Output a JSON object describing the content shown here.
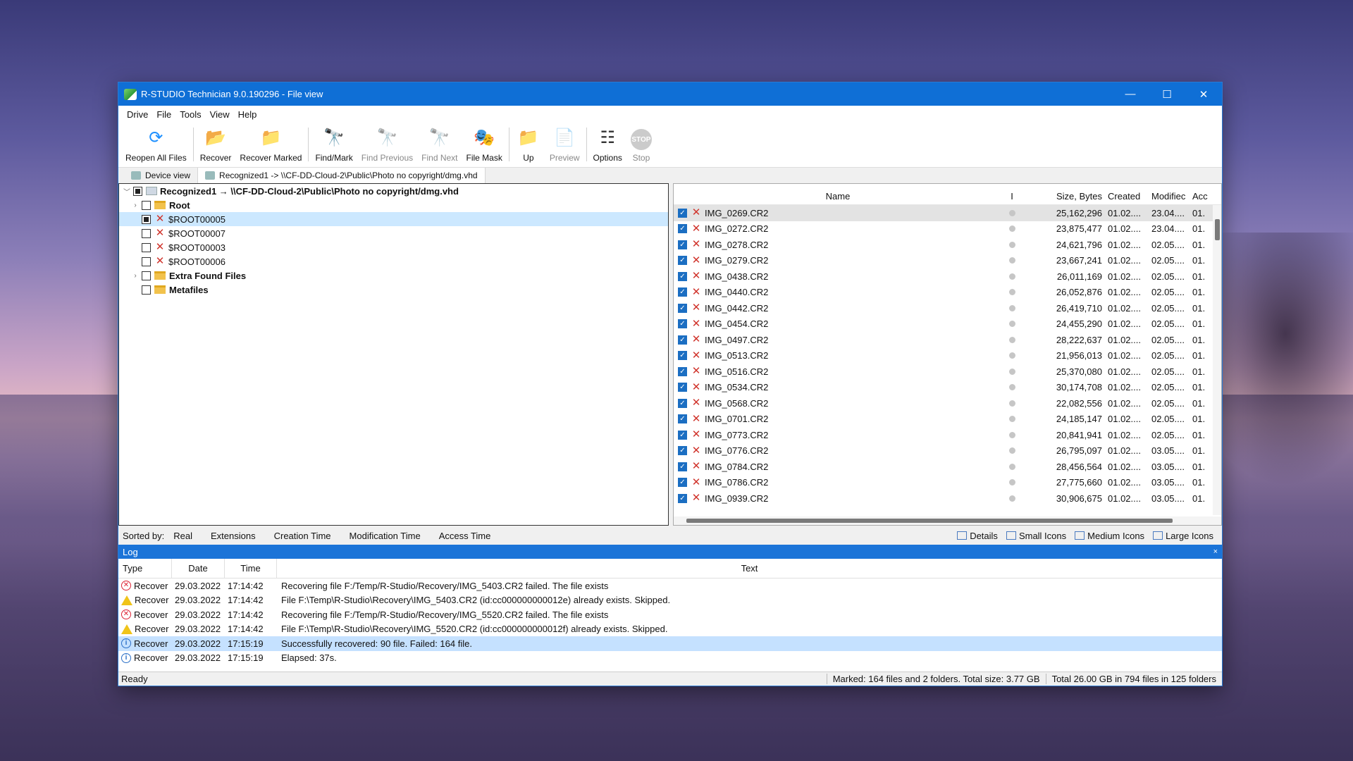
{
  "window": {
    "title": "R-STUDIO Technician 9.0.190296 - File view",
    "controls": {
      "minimize": "—",
      "maximize": "☐",
      "close": "✕"
    }
  },
  "menu": [
    "Drive",
    "File",
    "Tools",
    "View",
    "Help"
  ],
  "toolbar": [
    {
      "label": "Reopen All Files",
      "icon": "reopen-icon",
      "glyph": "⟳",
      "color": "#1e90ff",
      "disabled": false
    },
    {
      "label": "Recover",
      "icon": "recover-icon",
      "glyph": "📂",
      "color": "#c0392b",
      "disabled": false
    },
    {
      "label": "Recover Marked",
      "icon": "recover-marked-icon",
      "glyph": "📁",
      "color": "#c0392b",
      "disabled": false
    },
    {
      "label": "Find/Mark",
      "icon": "binoculars-icon",
      "glyph": "🔭",
      "color": "#444",
      "disabled": false
    },
    {
      "label": "Find Previous",
      "icon": "find-previous-icon",
      "glyph": "🔭",
      "color": "#888",
      "disabled": true
    },
    {
      "label": "Find Next",
      "icon": "find-next-icon",
      "glyph": "🔭",
      "color": "#888",
      "disabled": true
    },
    {
      "label": "File Mask",
      "icon": "file-mask-icon",
      "glyph": "🎭",
      "color": "#e0a820",
      "disabled": false
    },
    {
      "label": "Up",
      "icon": "folder-up-icon",
      "glyph": "📁",
      "color": "#e0a820",
      "disabled": false
    },
    {
      "label": "Preview",
      "icon": "preview-icon",
      "glyph": "📄",
      "color": "#888",
      "disabled": true
    },
    {
      "label": "Options",
      "icon": "options-icon",
      "glyph": "☷",
      "color": "#333",
      "disabled": false
    },
    {
      "label": "Stop",
      "icon": "stop-icon",
      "glyph": "STOP",
      "color": "#888",
      "disabled": true
    }
  ],
  "tabs": [
    {
      "label": "Device view",
      "active": false
    },
    {
      "label": "Recognized1 -> \\\\CF-DD-Cloud-2\\Public\\Photo no copyright/dmg.vhd",
      "active": true
    }
  ],
  "tree": [
    {
      "label": "Recognized1 → \\\\CF-DD-Cloud-2\\Public\\Photo no copyright/dmg.vhd",
      "level": 0,
      "expander": "﹀",
      "check": "partial",
      "icon": "drive-icon",
      "bold": true,
      "selected": false
    },
    {
      "label": "Root",
      "level": 1,
      "expander": "›",
      "check": "none",
      "icon": "folder-icon",
      "bold": true,
      "selected": false
    },
    {
      "label": "$ROOT00005",
      "level": 1,
      "expander": "",
      "check": "partial",
      "icon": "deleted-icon",
      "bold": false,
      "selected": true
    },
    {
      "label": "$ROOT00007",
      "level": 1,
      "expander": "",
      "check": "none",
      "icon": "deleted-icon",
      "bold": false,
      "selected": false
    },
    {
      "label": "$ROOT00003",
      "level": 1,
      "expander": "",
      "check": "none",
      "icon": "deleted-icon",
      "bold": false,
      "selected": false
    },
    {
      "label": "$ROOT00006",
      "level": 1,
      "expander": "",
      "check": "none",
      "icon": "deleted-icon",
      "bold": false,
      "selected": false
    },
    {
      "label": "Extra Found Files",
      "level": 1,
      "expander": "›",
      "check": "none",
      "icon": "folder-icon",
      "bold": true,
      "selected": false
    },
    {
      "label": "Metafiles",
      "level": 1,
      "expander": "",
      "check": "none",
      "icon": "folder-icon",
      "bold": true,
      "selected": false
    }
  ],
  "files": {
    "columns": [
      "Name",
      "I",
      "Size, Bytes",
      "Created",
      "Modifiec",
      "Acc"
    ],
    "rows": [
      {
        "name": "IMG_0269.CR2",
        "size": "25,162,296",
        "created": "01.02....",
        "modified": "23.04....",
        "accessed": "01."
      },
      {
        "name": "IMG_0272.CR2",
        "size": "23,875,477",
        "created": "01.02....",
        "modified": "23.04....",
        "accessed": "01."
      },
      {
        "name": "IMG_0278.CR2",
        "size": "24,621,796",
        "created": "01.02....",
        "modified": "02.05....",
        "accessed": "01."
      },
      {
        "name": "IMG_0279.CR2",
        "size": "23,667,241",
        "created": "01.02....",
        "modified": "02.05....",
        "accessed": "01."
      },
      {
        "name": "IMG_0438.CR2",
        "size": "26,011,169",
        "created": "01.02....",
        "modified": "02.05....",
        "accessed": "01."
      },
      {
        "name": "IMG_0440.CR2",
        "size": "26,052,876",
        "created": "01.02....",
        "modified": "02.05....",
        "accessed": "01."
      },
      {
        "name": "IMG_0442.CR2",
        "size": "26,419,710",
        "created": "01.02....",
        "modified": "02.05....",
        "accessed": "01."
      },
      {
        "name": "IMG_0454.CR2",
        "size": "24,455,290",
        "created": "01.02....",
        "modified": "02.05....",
        "accessed": "01."
      },
      {
        "name": "IMG_0497.CR2",
        "size": "28,222,637",
        "created": "01.02....",
        "modified": "02.05....",
        "accessed": "01."
      },
      {
        "name": "IMG_0513.CR2",
        "size": "21,956,013",
        "created": "01.02....",
        "modified": "02.05....",
        "accessed": "01."
      },
      {
        "name": "IMG_0516.CR2",
        "size": "25,370,080",
        "created": "01.02....",
        "modified": "02.05....",
        "accessed": "01."
      },
      {
        "name": "IMG_0534.CR2",
        "size": "30,174,708",
        "created": "01.02....",
        "modified": "02.05....",
        "accessed": "01."
      },
      {
        "name": "IMG_0568.CR2",
        "size": "22,082,556",
        "created": "01.02....",
        "modified": "02.05....",
        "accessed": "01."
      },
      {
        "name": "IMG_0701.CR2",
        "size": "24,185,147",
        "created": "01.02....",
        "modified": "02.05....",
        "accessed": "01."
      },
      {
        "name": "IMG_0773.CR2",
        "size": "20,841,941",
        "created": "01.02....",
        "modified": "02.05....",
        "accessed": "01."
      },
      {
        "name": "IMG_0776.CR2",
        "size": "26,795,097",
        "created": "01.02....",
        "modified": "03.05....",
        "accessed": "01."
      },
      {
        "name": "IMG_0784.CR2",
        "size": "28,456,564",
        "created": "01.02....",
        "modified": "03.05....",
        "accessed": "01."
      },
      {
        "name": "IMG_0786.CR2",
        "size": "27,775,660",
        "created": "01.02....",
        "modified": "03.05....",
        "accessed": "01."
      },
      {
        "name": "IMG_0939.CR2",
        "size": "30,906,675",
        "created": "01.02....",
        "modified": "03.05....",
        "accessed": "01."
      }
    ]
  },
  "sortbar": {
    "label": "Sorted by:",
    "options": [
      "Real",
      "Extensions",
      "Creation Time",
      "Modification Time",
      "Access Time"
    ],
    "views": [
      "Details",
      "Small Icons",
      "Medium Icons",
      "Large Icons"
    ]
  },
  "log": {
    "title": "Log",
    "close": "×",
    "columns": [
      "Type",
      "Date",
      "Time",
      "Text"
    ],
    "rows": [
      {
        "kind": "error",
        "type": "Recover",
        "date": "29.03.2022",
        "time": "17:14:42",
        "text": "Recovering file F:/Temp/R-Studio/Recovery/IMG_5403.CR2 failed. The file exists",
        "selected": false
      },
      {
        "kind": "warning",
        "type": "Recover",
        "date": "29.03.2022",
        "time": "17:14:42",
        "text": "File F:\\Temp\\R-Studio\\Recovery\\IMG_5403.CR2 (id:cc000000000012e) already exists. Skipped.",
        "selected": false
      },
      {
        "kind": "error",
        "type": "Recover",
        "date": "29.03.2022",
        "time": "17:14:42",
        "text": "Recovering file F:/Temp/R-Studio/Recovery/IMG_5520.CR2 failed. The file exists",
        "selected": false
      },
      {
        "kind": "warning",
        "type": "Recover",
        "date": "29.03.2022",
        "time": "17:14:42",
        "text": "File F:\\Temp\\R-Studio\\Recovery\\IMG_5520.CR2 (id:cc000000000012f) already exists. Skipped.",
        "selected": false
      },
      {
        "kind": "info",
        "type": "Recover",
        "date": "29.03.2022",
        "time": "17:15:19",
        "text": "Successfully recovered: 90 file. Failed: 164 file.",
        "selected": true
      },
      {
        "kind": "info",
        "type": "Recover",
        "date": "29.03.2022",
        "time": "17:15:19",
        "text": "Elapsed: 37s.",
        "selected": false
      }
    ]
  },
  "status": {
    "ready": "Ready",
    "marked": "Marked: 164 files and 2 folders. Total size: 3.77 GB",
    "total": "Total 26.00 GB in 794 files in 125 folders"
  }
}
